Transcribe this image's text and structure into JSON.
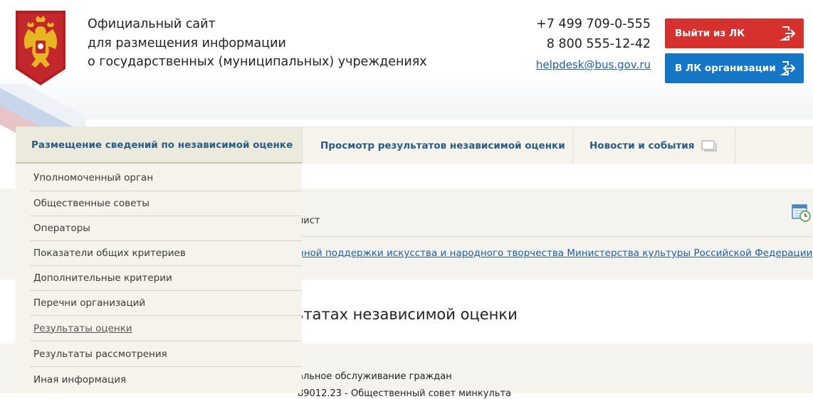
{
  "header": {
    "title_lines": [
      "Официальный сайт",
      "для размещения информации",
      "о государственных (муниципальных) учреждениях"
    ],
    "phones": [
      "+7 499 709-0-555",
      "8 800 555-12-42"
    ],
    "email": "helpdesk@bus.gov.ru",
    "buttons": {
      "exit_label": "Выйти из ЛК",
      "org_label": "В ЛК организации"
    },
    "colors": {
      "exit": "#d6312f",
      "org": "#1676c6"
    },
    "emblem": "russian-coat-of-arms"
  },
  "nav": {
    "items": [
      {
        "label": "Размещение сведений по независимой оценке",
        "active": true
      },
      {
        "label": "Просмотр результатов независимой оценки"
      },
      {
        "label": "Новости и события",
        "icon": "chat-icon"
      }
    ]
  },
  "dropdown": {
    "items": [
      "Уполномоченный орган",
      "Общественные советы",
      "Операторы",
      "Показатели общих критериев",
      "Дополнительные критерии",
      "Перечни организаций",
      "Результаты оценки",
      "Результаты рассмотрения",
      "Иная информация"
    ],
    "current": "Результаты оценки"
  },
  "content": {
    "list_text": "лист",
    "link_text": "нной поддержки искусства и народного творчества Министерства культуры Российской Федерации",
    "heading": "ьтатах независимой оценки",
    "line1": "альное обслуживание граждан",
    "line2": "89012.23 - Общественный совет минкульта"
  }
}
